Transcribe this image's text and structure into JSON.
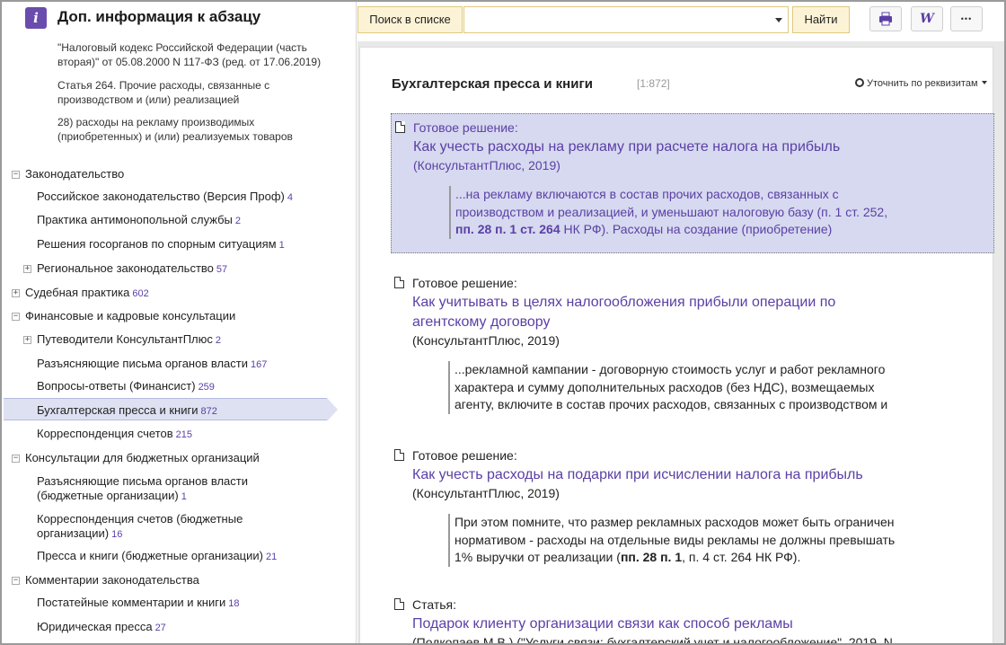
{
  "panel": {
    "title": "Доп. информация к абзацу",
    "logo": "i",
    "context": [
      "\"Налоговый кодекс Российской Федерации (часть вторая)\" от 05.08.2000 N 117-ФЗ (ред. от 17.06.2019)",
      "Статья 264. Прочие расходы, связанные с производством и (или) реализацией",
      "28) расходы на рекламу производимых (приобретенных) и (или) реализуемых товаров"
    ]
  },
  "tree": [
    {
      "label": "Законодательство",
      "count": "",
      "toggle": "−"
    },
    {
      "label": "Российское законодательство (Версия Проф)",
      "count": "4",
      "toggle": ""
    },
    {
      "label": "Практика антимонопольной службы",
      "count": "2",
      "toggle": ""
    },
    {
      "label": "Решения госорганов по спорным ситуациям",
      "count": "1",
      "toggle": ""
    },
    {
      "label": "Региональное законодательство",
      "count": "57",
      "toggle": "+"
    },
    {
      "label": "Судебная практика",
      "count": "602",
      "toggle": "+"
    },
    {
      "label": "Финансовые и кадровые консультации",
      "count": "",
      "toggle": "−"
    },
    {
      "label": "Путеводители КонсультантПлюс",
      "count": "2",
      "toggle": "+"
    },
    {
      "label": "Разъясняющие письма органов власти",
      "count": "167",
      "toggle": ""
    },
    {
      "label": "Вопросы-ответы (Финансист)",
      "count": "259",
      "toggle": ""
    },
    {
      "label": "Бухгалтерская пресса и книги",
      "count": "872",
      "toggle": ""
    },
    {
      "label": "Корреспонденция счетов",
      "count": "215",
      "toggle": ""
    },
    {
      "label": "Консультации для бюджетных организаций",
      "count": "",
      "toggle": "−"
    },
    {
      "label": "Разъясняющие письма органов власти",
      "label2": "(бюджетные организации)",
      "count": "1",
      "toggle": ""
    },
    {
      "label": "Корреспонденция счетов (бюджетные",
      "label2": "организации)",
      "count": "16",
      "toggle": ""
    },
    {
      "label": "Пресса и книги (бюджетные организации)",
      "count": "21",
      "toggle": ""
    },
    {
      "label": "Комментарии законодательства",
      "count": "",
      "toggle": "−"
    },
    {
      "label": "Постатейные комментарии и книги",
      "count": "18",
      "toggle": ""
    },
    {
      "label": "Юридическая пресса",
      "count": "27",
      "toggle": ""
    }
  ],
  "toolbar": {
    "search_label": "Поиск в списке",
    "search_value": "",
    "find_button": "Найти",
    "word_icon": "W",
    "more_icon": "•••"
  },
  "section": {
    "title": "Бухгалтерская пресса и книги",
    "count": "[1:872]",
    "refine": "Уточнить по реквизитам"
  },
  "results": [
    {
      "type": "Готовое решение:",
      "title_lines": [
        "Как учесть расходы на рекламу при расчете налога на прибыль"
      ],
      "source": "(КонсультантПлюс, 2019)",
      "snippet_html": "...на рекламу включаются в состав прочих расходов, связанных с<br>производством и реализацией, и уменьшают налоговую базу (п. 1 ст. 252,<br><b>пп. 28 п. 1 ст. 264</b> НК РФ). Расходы на создание (приобретение)"
    },
    {
      "type": "Готовое решение:",
      "title_lines": [
        "Как учитывать в целях налогообложения прибыли операции по",
        "агентскому договору"
      ],
      "source": "(КонсультантПлюс, 2019)",
      "snippet_html": "...рекламной кампании - договорную стоимость услуг и работ рекламного<br>характера и сумму дополнительных расходов (без НДС), возмещаемых<br>агенту, включите в состав прочих расходов, связанных с производством и"
    },
    {
      "type": "Готовое решение:",
      "title_lines": [
        "Как учесть расходы на подарки при исчислении налога на прибыль"
      ],
      "source": "(КонсультантПлюс, 2019)",
      "snippet_html": "При этом помните, что размер рекламных расходов может быть ограничен<br>нормативом - расходы на отдельные виды рекламы не должны превышать<br>1% выручки от реализации (<b>пп. 28 п. 1</b>, п. 4 ст. 264 НК РФ)."
    },
    {
      "type": "Статья:",
      "title_lines": [
        "Подарок клиенту организации связи как способ рекламы"
      ],
      "source": "(Подкопаев М.В.) (\"Услуги связи: бухгалтерский учет и налогообложение\", 2019, N",
      "snippet_html": ""
    }
  ],
  "colors": {
    "accent": "#5b3fa6",
    "highlight": "#d6d9ef",
    "search_bg": "#fcf3d7"
  }
}
